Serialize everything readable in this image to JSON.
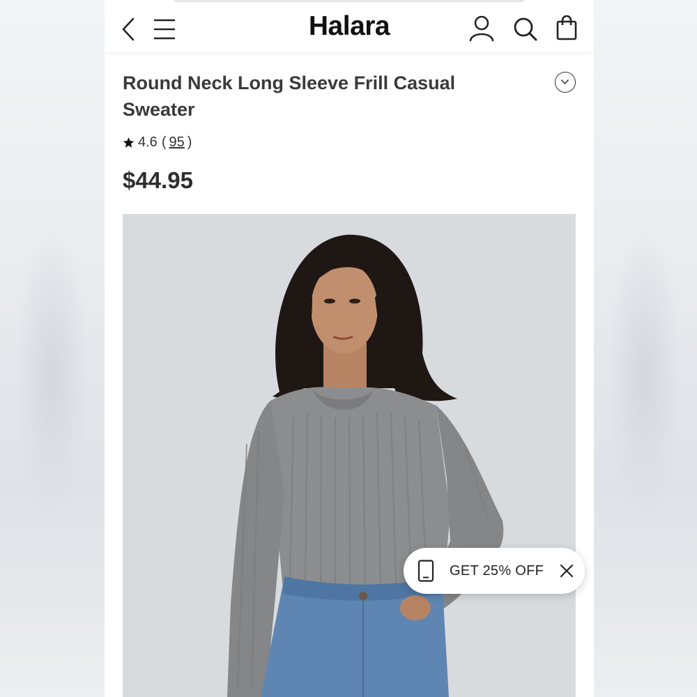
{
  "header": {
    "logo": "Halara",
    "icons": [
      "back-chevron-icon",
      "menu-icon",
      "account-icon",
      "search-icon",
      "shopping-bag-icon"
    ]
  },
  "product": {
    "title": "Round Neck Long Sleeve Frill Casual Sweater",
    "rating": "4.6",
    "review_open": "(",
    "review_count": "95",
    "review_close": ")",
    "price": "$44.95"
  },
  "promo": {
    "label": "GET 25% OFF",
    "icons": [
      "phone-icon",
      "close-icon"
    ]
  },
  "colors": {
    "text": "#3a3a3a",
    "photo_background": "#d8dbde",
    "sweater": "#8c8d8e",
    "denim": "#5f86b3"
  }
}
